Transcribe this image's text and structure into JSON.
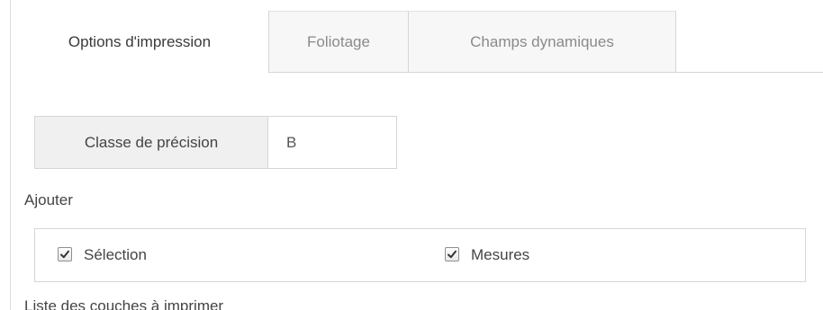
{
  "tabs": {
    "print_options": "Options d'impression",
    "pagination": "Foliotage",
    "dynamic_fields": "Champs dynamiques"
  },
  "precision": {
    "label": "Classe de précision",
    "value": "B"
  },
  "add_section": {
    "label": "Ajouter",
    "options": [
      {
        "label": "Sélection",
        "checked": true
      },
      {
        "label": "Mesures",
        "checked": true
      }
    ]
  },
  "layers_section": {
    "label": "Liste des couches à imprimer"
  },
  "icons": {
    "checkbox": "checkmark-icon"
  }
}
